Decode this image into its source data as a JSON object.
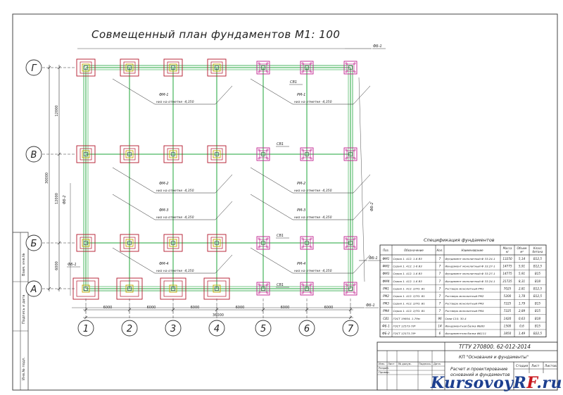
{
  "title": "Совмещенный план фундаментов М1: 100",
  "axes_letters": [
    "Г",
    "В",
    "Б",
    "А"
  ],
  "axes_numbers": [
    "1",
    "2",
    "3",
    "4",
    "5",
    "6",
    "7"
  ],
  "dims_bottom": [
    "6000",
    "6000",
    "6000",
    "6000",
    "6000",
    "6000"
  ],
  "dim_total": "36000",
  "dims_left": [
    "12000",
    "12000",
    "6000"
  ],
  "dim_left_total": "30000",
  "foundation_labels": [
    {
      "name": "ФМ-1",
      "note": "низ на отметке -4,350"
    },
    {
      "name": "РМ-1",
      "note": "низ на отметке -4,350"
    },
    {
      "name": "ФМ-2",
      "note": "низ на отметке -4,350"
    },
    {
      "name": "РМ-2",
      "note": "низ на отметке -4,350"
    },
    {
      "name": "ФМ-3",
      "note": "низ на отметке -4,350"
    },
    {
      "name": "РМ-3",
      "note": "низ на отметке -4,350"
    },
    {
      "name": "ФМ-4",
      "note": "низ на отметке -4,350"
    },
    {
      "name": "РМ-4",
      "note": "низ на отметке -4,350"
    }
  ],
  "beam_labels": {
    "fb1": "ФБ-1",
    "fb2": "ФБ-2",
    "sv": "СВ1"
  },
  "spec": {
    "title": "Спецификация фундаментов",
    "headers": [
      "Поз.",
      "Обозначение",
      "Кол.",
      "Наименование",
      "Масса кг",
      "Объем м³",
      "Класс бетона"
    ],
    "rows": [
      [
        "ФМ1",
        "Серия 1. 412. 1-6 В3",
        "7",
        "Фундамент монолитный Ф 33.24-1",
        "13250",
        "5,14",
        "В12,5"
      ],
      [
        "ФМ2",
        "Серия 1. 412. 1-6 В3",
        "7",
        "Фундамент монолитный Ф 33.27-1",
        "14775",
        "5,91",
        "В12,5"
      ],
      [
        "ФМ3",
        "Серия 1. 412. 1-6 В3",
        "7",
        "Фундамент монолитный Ф 33.27-1",
        "14775",
        "5,91",
        "В15"
      ],
      [
        "ФМ4",
        "Серия 1. 412. 1-6 В3",
        "7",
        "Фундамент монолитный Ф 33.24-1",
        "21725",
        "8,31",
        "В18"
      ],
      [
        "РМ1",
        "Серия 1. 412. 2/ТО. В1",
        "7",
        "Ростверк монолитный РМ1",
        "7025",
        "2,81",
        "В12,5"
      ],
      [
        "РМ2",
        "Серия 1. 412. 2/ТО. В1",
        "7",
        "Ростверк монолитный РМ2",
        "5200",
        "1,78",
        "В12,5"
      ],
      [
        "РМ3",
        "Серия 1. 412. 2/ТО. В1",
        "7",
        "Ростверк монолитный РМ3",
        "7225",
        "1,79",
        "В15"
      ],
      [
        "РМ4",
        "Серия 1. 412. 2/ТО. В1",
        "7",
        "Ростверк монолитный РМ4",
        "7225",
        "2,89",
        "В15"
      ],
      [
        "СВ1",
        "ГОСТ 19804. 1-79м",
        "96",
        "Сваи С10. 30-4",
        "1420",
        "0,63",
        "В18"
      ],
      [
        "ФБ-1",
        "ГОСТ 12573-78*",
        "14",
        "Фундаментная балка ФБ60",
        "1500",
        "0,6",
        "В15"
      ],
      [
        "ФБ-2",
        "ГОСТ 12573-78*",
        "6",
        "Фундаментная балка ФБ111",
        "3850",
        "1,49",
        "В22,5"
      ]
    ]
  },
  "stamp": {
    "code": "ТГТУ 270800. 62-012-2014",
    "course": "КП \"Основания и фундаменты\"",
    "drawing_title": "Расчет и проектирование оснований и фундаментов",
    "stage_header": "Стадия",
    "sheet_header": "Лист",
    "sheets_header": "Листов",
    "left_labels": [
      "Изм.",
      "Лист",
      "№ докум.",
      "Подпись",
      "Дата"
    ],
    "roles": [
      "Разраб.",
      "Провер."
    ]
  },
  "side_strip": [
    "Инв.№ подл.",
    "Подпись и дата",
    "Взам. инв.№"
  ],
  "watermark": {
    "main": "KursovoyR",
    "accent": "F",
    "tail": ".ru"
  },
  "colors": {
    "grid": "#1fa43a",
    "foundation_rigid": "#b3152a",
    "pile_grid": "#c0208e",
    "ink": "#222222",
    "watermark_blue": "#1d3f8f",
    "watermark_red": "#c8171e"
  }
}
